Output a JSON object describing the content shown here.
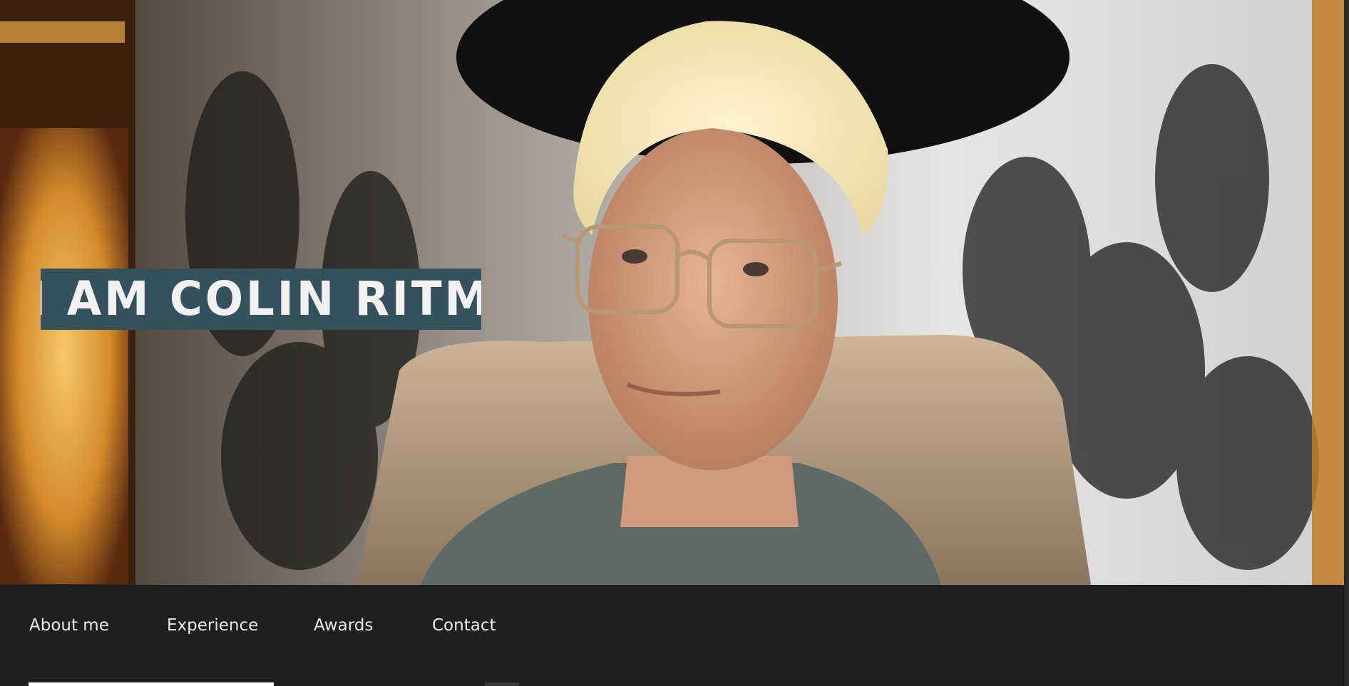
{
  "hero": {
    "headline": "I am Colin Ritman"
  },
  "nav": {
    "items": [
      {
        "label": "About me"
      },
      {
        "label": "Experience"
      },
      {
        "label": "Awards"
      },
      {
        "label": "Contact"
      }
    ]
  },
  "colors": {
    "title_bg": "#34515c",
    "nav_bg": "#1f1f1f",
    "nav_text": "#e9e9e9"
  }
}
